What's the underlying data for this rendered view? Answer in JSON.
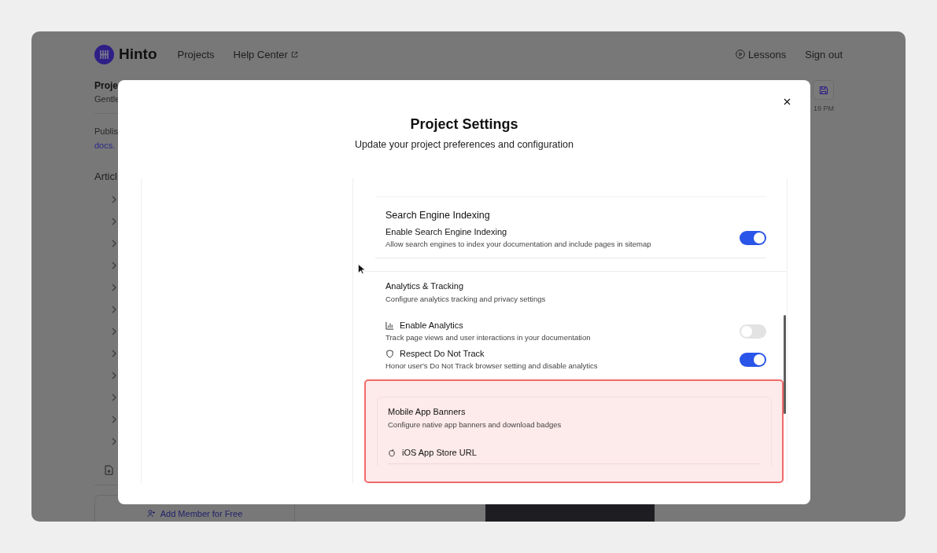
{
  "nav": {
    "logo": "Hinto",
    "links": [
      {
        "label": "Projects",
        "external": false
      },
      {
        "label": "Help Center",
        "external": true
      }
    ],
    "actions": [
      {
        "label": "Lessons"
      },
      {
        "label": "Sign out"
      }
    ]
  },
  "background": {
    "project_title": "Proje",
    "project_subtitle": "Gentle",
    "published_label": "Publis",
    "published_link": "docs.",
    "articles_heading": "Articl",
    "timestamp": "19 PM",
    "add_member_button": "Add Member for Free"
  },
  "dialog": {
    "title": "Project Settings",
    "subtitle": "Update your project preferences and configuration",
    "sections": [
      {
        "title": "Search Engine Indexing",
        "highlighted": false,
        "settings": [
          {
            "kind": "toggle",
            "label": "Enable Search Engine Indexing",
            "description": "Allow search engines to index your documentation and include pages in sitemap",
            "on": true
          }
        ]
      },
      {
        "title": "Analytics & Tracking",
        "description": "Configure analytics tracking and privacy settings",
        "highlighted": false,
        "settings": [
          {
            "kind": "toggle",
            "label": "Enable Analytics",
            "description": "Track page views and user interactions in your documentation",
            "on": false
          },
          {
            "kind": "toggle",
            "label": "Respect Do Not Track",
            "description": "Honor user's Do Not Track browser setting and disable analytics",
            "on": true
          }
        ]
      },
      {
        "title": "Mobile App Banners",
        "description": "Configure native app banners and download badges",
        "highlighted": true,
        "settings": [
          {
            "kind": "field",
            "label": "iOS App Store URL"
          }
        ]
      }
    ]
  }
}
